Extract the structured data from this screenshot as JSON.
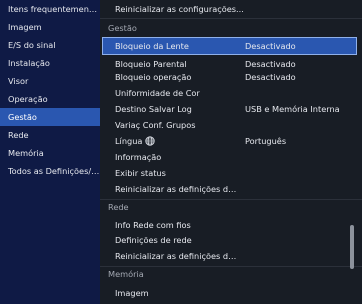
{
  "sidebar": {
    "items": [
      {
        "label": "Itens frequentemente..."
      },
      {
        "label": "Imagem"
      },
      {
        "label": "E/S do sinal"
      },
      {
        "label": "Instalação"
      },
      {
        "label": "Visor"
      },
      {
        "label": "Operação"
      },
      {
        "label": "Gestão"
      },
      {
        "label": "Rede"
      },
      {
        "label": "Memória"
      },
      {
        "label": "Todos as Definições/Ini..."
      }
    ],
    "active": "Gestão"
  },
  "main": {
    "top_item": "Reinicializar as configurações...",
    "sections": [
      {
        "header": "Gestão",
        "rows": [
          {
            "label": "Bloqueio da Lente",
            "value": "Desactivado"
          },
          {
            "label": "Bloqueio Parental",
            "value": "Desactivado"
          },
          {
            "label": "Bloqueio operação",
            "value": "Desactivado"
          },
          {
            "label": "Uniformidade de Cor",
            "value": ""
          },
          {
            "label": "Destino Salvar Log",
            "value": "USB e Memória Interna"
          },
          {
            "label": "Variaç Conf. Grupos",
            "value": ""
          },
          {
            "label": "Língua",
            "value": "Português"
          },
          {
            "label": "Informação",
            "value": ""
          },
          {
            "label": "Exibir status",
            "value": ""
          },
          {
            "label": "Reinicializar as definições de ...",
            "value": ""
          }
        ]
      },
      {
        "header": "Rede",
        "rows": [
          {
            "label": "Info Rede com fios",
            "value": ""
          },
          {
            "label": "Definições de rede",
            "value": ""
          },
          {
            "label": "Reinicializar as definições de ...",
            "value": ""
          }
        ]
      },
      {
        "header": "Memória",
        "rows": [
          {
            "label": "Imagem",
            "value": ""
          }
        ]
      }
    ],
    "selected_row": "Bloqueio da Lente"
  },
  "icons": {
    "language": "globe-icon",
    "scrollbar": "scrollbar-thumb"
  },
  "colors": {
    "sidebar_bg": "#0f1a45",
    "main_bg": "#181d25",
    "highlight": "#2a57b0",
    "selection_border": "#8fb0ea",
    "section_header_text": "#a3a8b2"
  }
}
